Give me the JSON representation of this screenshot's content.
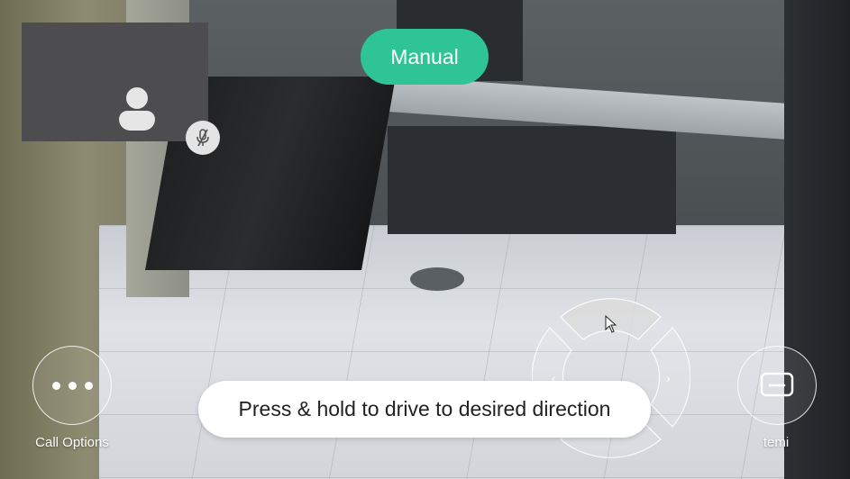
{
  "mode": {
    "label": "Manual",
    "color": "#2fc494"
  },
  "self_view": {
    "avatar_icon": "user-silhouette-icon",
    "mic_status_icon": "mic-muted-icon"
  },
  "controls": {
    "call_options": {
      "icon": "more-dots-icon",
      "label": "Call Options"
    },
    "temi": {
      "icon": "temi-robot-icon",
      "label": "temi"
    }
  },
  "joystick": {
    "icons": [
      "arrow-forward-segment",
      "arrow-left-segment",
      "arrow-right-segment",
      "arrow-back-segment"
    ],
    "left_glyph": "‹",
    "right_glyph": "›"
  },
  "hint": {
    "text": "Press & hold to drive to desired direction"
  }
}
